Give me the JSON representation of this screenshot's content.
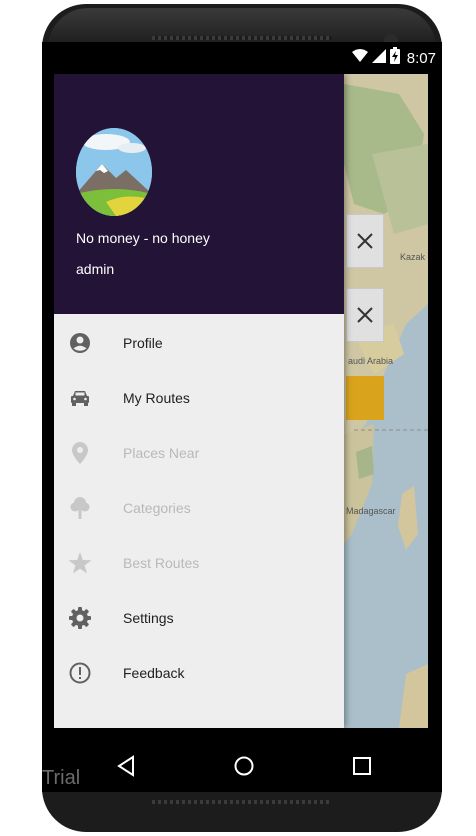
{
  "status_bar": {
    "time": "8:07",
    "icons": [
      "wifi-icon",
      "cell-signal-icon",
      "battery-charging-icon"
    ]
  },
  "drawer": {
    "header": {
      "title": "No money - no honey",
      "subtitle": "admin",
      "background_color": "#231336"
    },
    "items": [
      {
        "label": "Profile",
        "icon": "account-circle-icon",
        "enabled": true
      },
      {
        "label": "My Routes",
        "icon": "car-icon",
        "enabled": true
      },
      {
        "label": "Places Near",
        "icon": "location-pin-icon",
        "enabled": false
      },
      {
        "label": "Categories",
        "icon": "tree-icon",
        "enabled": false
      },
      {
        "label": "Best Routes",
        "icon": "star-icon",
        "enabled": false
      },
      {
        "label": "Settings",
        "icon": "gear-icon",
        "enabled": true
      },
      {
        "label": "Feedback",
        "icon": "alert-circle-icon",
        "enabled": true
      }
    ]
  },
  "map": {
    "labels": [
      "Kazak",
      "audi Arabia",
      "Madagascar"
    ]
  },
  "watermark": "Trial",
  "colors": {
    "enabled_text": "#212121",
    "disabled_text": "#b9b9b9",
    "enabled_icon": "#616161",
    "disabled_icon": "#c8c8c8",
    "map_button_accent": "#d9a31c"
  }
}
